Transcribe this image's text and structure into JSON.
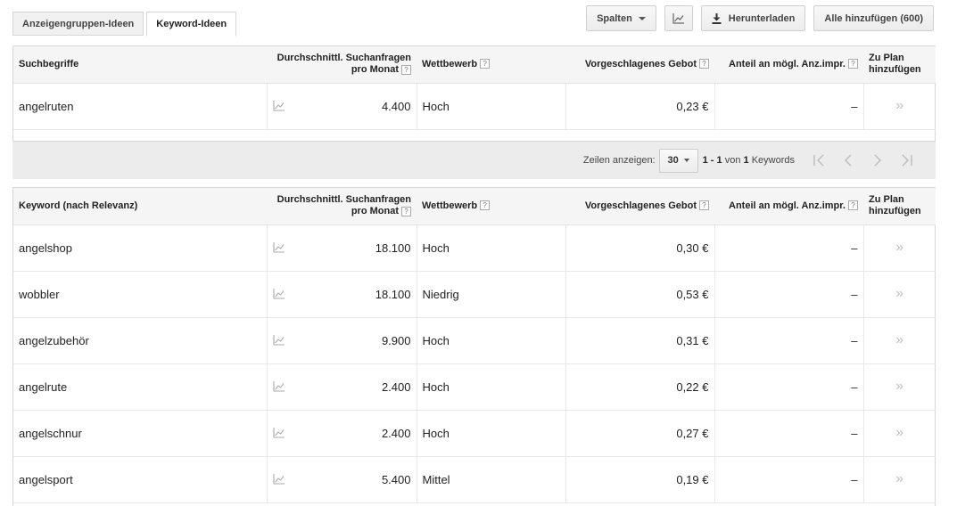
{
  "tabs": [
    {
      "label": "Anzeigengruppen-Ideen",
      "active": false
    },
    {
      "label": "Keyword-Ideen",
      "active": true
    }
  ],
  "toolbar": {
    "columns_label": "Spalten",
    "chart_icon": "chart-icon",
    "download_label": "Herunterladen",
    "add_all_label": "Alle hinzufügen (600)"
  },
  "columns": {
    "search": "Durchschnittl. Suchanfragen",
    "search2": "pro Monat",
    "competition": "Wettbewerb",
    "bid": "Vorgeschlagenes Gebot",
    "share": "Anteil an mögl. Anz.impr.",
    "add1": "Zu Plan",
    "add2": "hinzufügen"
  },
  "top_table": {
    "first_header": "Suchbegriffe",
    "rows": [
      {
        "keyword": "angelruten",
        "searches": "4.400",
        "competition": "Hoch",
        "bid": "0,23 €",
        "share": "–",
        "add": "»"
      }
    ]
  },
  "pager": {
    "rows_label": "Zeilen anzeigen:",
    "rows_value": "30",
    "range_prefix": "1 - 1",
    "range_mid": "von",
    "range_count": "1",
    "range_suffix": "Keywords"
  },
  "bottom_table": {
    "first_header": "Keyword (nach Relevanz)",
    "rows": [
      {
        "keyword": "angelshop",
        "searches": "18.100",
        "competition": "Hoch",
        "bid": "0,30 €",
        "share": "–",
        "add": "»"
      },
      {
        "keyword": "wobbler",
        "searches": "18.100",
        "competition": "Niedrig",
        "bid": "0,53 €",
        "share": "–",
        "add": "»"
      },
      {
        "keyword": "angelzubehör",
        "searches": "9.900",
        "competition": "Hoch",
        "bid": "0,31 €",
        "share": "–",
        "add": "»"
      },
      {
        "keyword": "angelrute",
        "searches": "2.400",
        "competition": "Hoch",
        "bid": "0,22 €",
        "share": "–",
        "add": "»"
      },
      {
        "keyword": "angelschnur",
        "searches": "2.400",
        "competition": "Hoch",
        "bid": "0,27 €",
        "share": "–",
        "add": "»"
      },
      {
        "keyword": "angelsport",
        "searches": "5.400",
        "competition": "Mittel",
        "bid": "0,19 €",
        "share": "–",
        "add": "»"
      }
    ]
  },
  "help_glyph": "?"
}
